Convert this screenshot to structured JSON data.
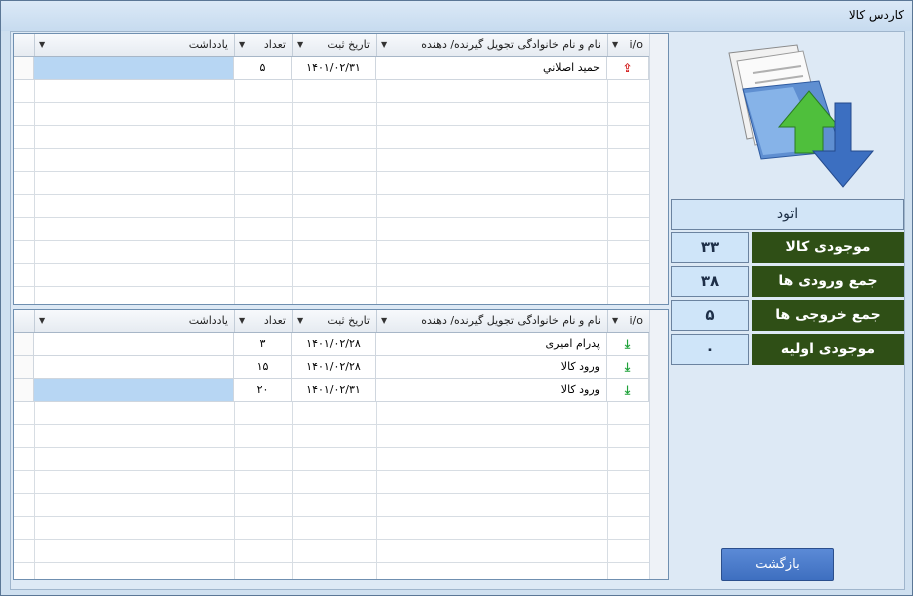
{
  "window": {
    "title": "کاردس کالا"
  },
  "grid_top": {
    "headers": {
      "io": "i/o",
      "name": "نام و نام خانوادگی تجویل گیرنده/ دهنده",
      "date": "تاریخ ثبت",
      "qty": "تعداد",
      "note": "یادداشت"
    },
    "rows": [
      {
        "io": "out",
        "name": "حميد اصلاني",
        "date": "۱۴۰۱/۰۲/۳۱",
        "qty": "۵",
        "note": ""
      }
    ]
  },
  "grid_bottom": {
    "headers": {
      "io": "i/o",
      "name": "نام و نام خانوادگی تجویل گیرنده/ دهنده",
      "date": "تاریخ ثبت",
      "qty": "تعداد",
      "note": "یادداشت"
    },
    "rows": [
      {
        "io": "in",
        "name": "پدرام امیری",
        "date": "۱۴۰۱/۰۲/۲۸",
        "qty": "۳",
        "note": ""
      },
      {
        "io": "in",
        "name": "ورود کالا",
        "date": "۱۴۰۱/۰۲/۲۸",
        "qty": "۱۵",
        "note": ""
      },
      {
        "io": "in",
        "name": "ورود کالا",
        "date": "۱۴۰۱/۰۲/۳۱",
        "qty": "۲۰",
        "note": ""
      }
    ]
  },
  "item_name": "اتود",
  "stats": [
    {
      "label": "موجودی کالا",
      "value": "۳۳"
    },
    {
      "label": "جمع ورودی ها",
      "value": "۳۸"
    },
    {
      "label": "جمع خروجی ها",
      "value": "۵"
    },
    {
      "label": "موجودی اولیه",
      "value": "۰"
    }
  ],
  "buttons": {
    "back": "بازگشت"
  },
  "icons": {
    "logo": "document-transfer-icon",
    "in": "download-green-icon",
    "out": "upload-red-icon"
  },
  "colors": {
    "stat_label_bg": "#2f4f16",
    "selected_row": "#b7d6f3",
    "button": "#4a79c9"
  }
}
